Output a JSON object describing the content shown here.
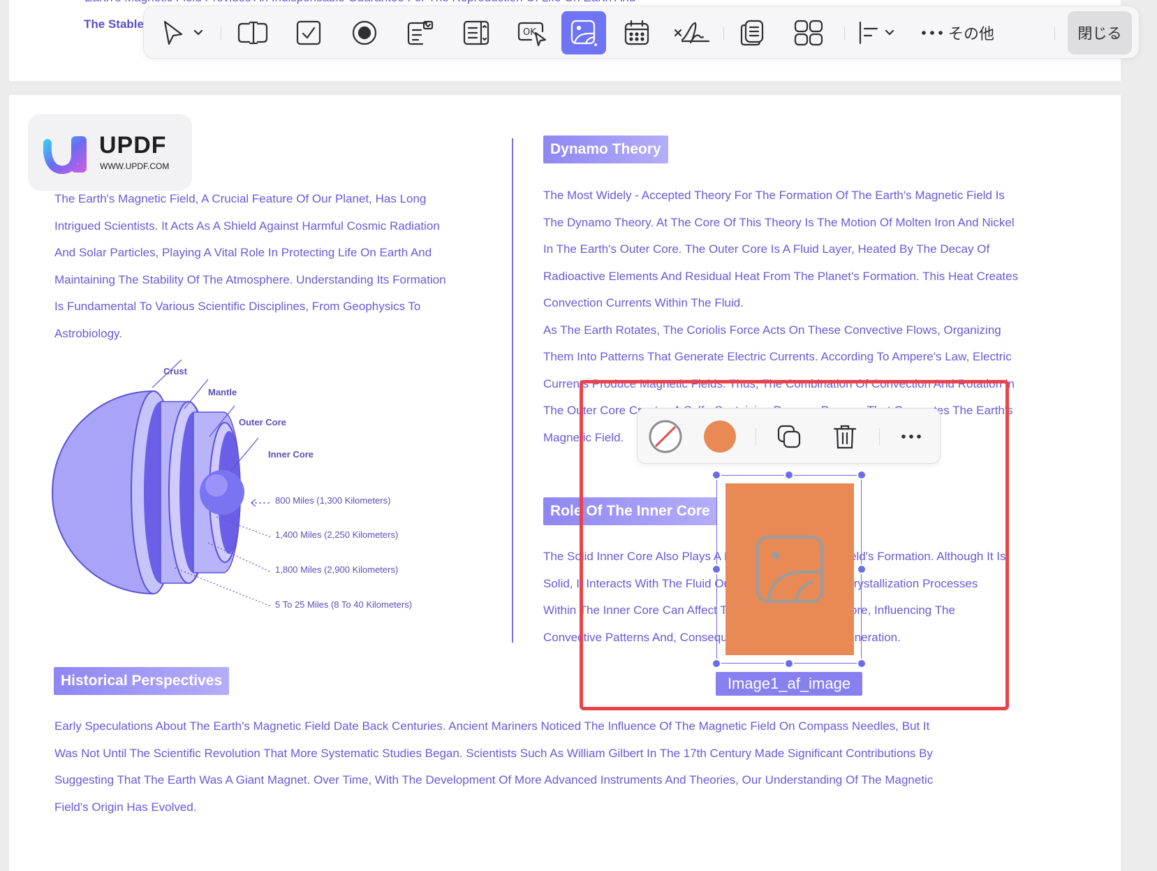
{
  "previous_page": {
    "top_line": "Earth's Magnetic Field Provides An Indispensable Guarantee For The Reproduction Of Life On Earth And",
    "left_fragment": "The Stable"
  },
  "toolbar": {
    "more_label": "その他",
    "close_label": "閉じる",
    "tools": [
      {
        "name": "select-tool",
        "icon": "pointer-icon"
      },
      {
        "name": "text-field-tool",
        "icon": "text-field-icon"
      },
      {
        "name": "checkbox-tool",
        "icon": "checkbox-icon"
      },
      {
        "name": "radio-tool",
        "icon": "radio-icon"
      },
      {
        "name": "combo-box-tool",
        "icon": "combo-box-icon"
      },
      {
        "name": "list-box-tool",
        "icon": "list-box-icon"
      },
      {
        "name": "button-tool",
        "icon": "ok-button-icon"
      },
      {
        "name": "image-field-tool",
        "icon": "image-icon",
        "active": true
      },
      {
        "name": "date-field-tool",
        "icon": "calendar-icon"
      },
      {
        "name": "signature-tool",
        "icon": "signature-icon"
      },
      {
        "name": "duplicate-tool",
        "icon": "copy-icon"
      },
      {
        "name": "grid-tool",
        "icon": "grid-icon"
      },
      {
        "name": "align-tool",
        "icon": "align-left-icon"
      }
    ],
    "ok_text": "OK"
  },
  "logo": {
    "brand": "UPDF",
    "url": "WWW.UPDF.COM"
  },
  "left_column": {
    "lines": [
      "The Earth's Magnetic Field, A Crucial Feature Of Our Planet, Has Long",
      "Intrigued Scientists. It Acts As A Shield Against Harmful Cosmic Radiation",
      "And Solar Particles, Playing A Vital Role In Protecting Life On Earth And",
      "Maintaining The Stability Of The Atmosphere. Understanding Its Formation",
      "Is Fundamental To Various Scientific Disciplines, From Geophysics To",
      "Astrobiology."
    ]
  },
  "diagram": {
    "labels": {
      "crust": "Crust",
      "mantle": "Mantle",
      "outer_core": "Outer Core",
      "inner_core": "Inner Core"
    },
    "measures": [
      "800 Miles (1,300 Kilometers)",
      "1,400 Miles (2,250 Kilometers)",
      "1,800 Miles (2,900 Kilometers)",
      "5 To 25 Miles (8 To 40 Kilometers)"
    ]
  },
  "dynamo": {
    "heading": "Dynamo Theory",
    "lines": [
      "The Most Widely - Accepted Theory For The Formation Of The Earth's Magnetic Field Is",
      "The Dynamo Theory. At The Core Of This Theory Is The Motion Of Molten Iron And Nickel",
      "In The Earth's Outer Core. The Outer Core Is A Fluid Layer, Heated By The Decay Of",
      "Radioactive Elements And Residual Heat From The Planet's Formation. This Heat Creates",
      "Convection Currents Within The Fluid.",
      "As The Earth Rotates, The Coriolis Force Acts On These Convective Flows, Organizing",
      "Them Into Patterns That Generate Electric Currents. According To Ampere's Law, Electric",
      "Currents Produce Magnetic Fields. Thus, The Combination Of Convection And Rotation in",
      "The Outer Core Creates A Self - Sustaining Dynamo Process That Generates The Earth's",
      "Magnetic Field."
    ]
  },
  "inner_core": {
    "heading": "Role Of The Inner Core",
    "lines": [
      "The Solid Inner Core Also Plays A Role In The Magnetic Field's Formation. Although It Is",
      "Solid, It Interacts With The Fluid Outer Core. Melting And Crystallization Processes",
      "Within The Inner Core Can Affect The Flow In The Outer Core, Influencing The",
      "Convective Patterns And, Consequently, Magnetic Field Generation."
    ]
  },
  "historical": {
    "heading": "Historical Perspectives",
    "lines": [
      "Early Speculations About The Earth's Magnetic Field Date Back Centuries. Ancient Mariners Noticed The Influence Of The Magnetic Field On Compass Needles, But It",
      "Was Not Until The Scientific Revolution That More Systematic Studies Began. Scientists Such As William Gilbert In The 17th Century Made Significant Contributions By",
      "Suggesting That The Earth Was A Giant Magnet. Over Time, With The Development Of More Advanced Instruments And Theories, Our Understanding Of The Magnetic",
      "Field's Origin Has Evolved."
    ]
  },
  "image_field": {
    "label": "Image1_af_image",
    "fill_color": "#e98a56",
    "border_color": "#6b6de8"
  },
  "float_toolbar": {
    "items": [
      "no-border-icon",
      "fill-color-swatch",
      "duplicate-icon",
      "trash-icon",
      "more-icon"
    ],
    "swatch_color": "#e98a56"
  },
  "colors": {
    "text": "#6a5ad8",
    "accent": "#6f74f5",
    "highlight_border": "#e9434b"
  }
}
